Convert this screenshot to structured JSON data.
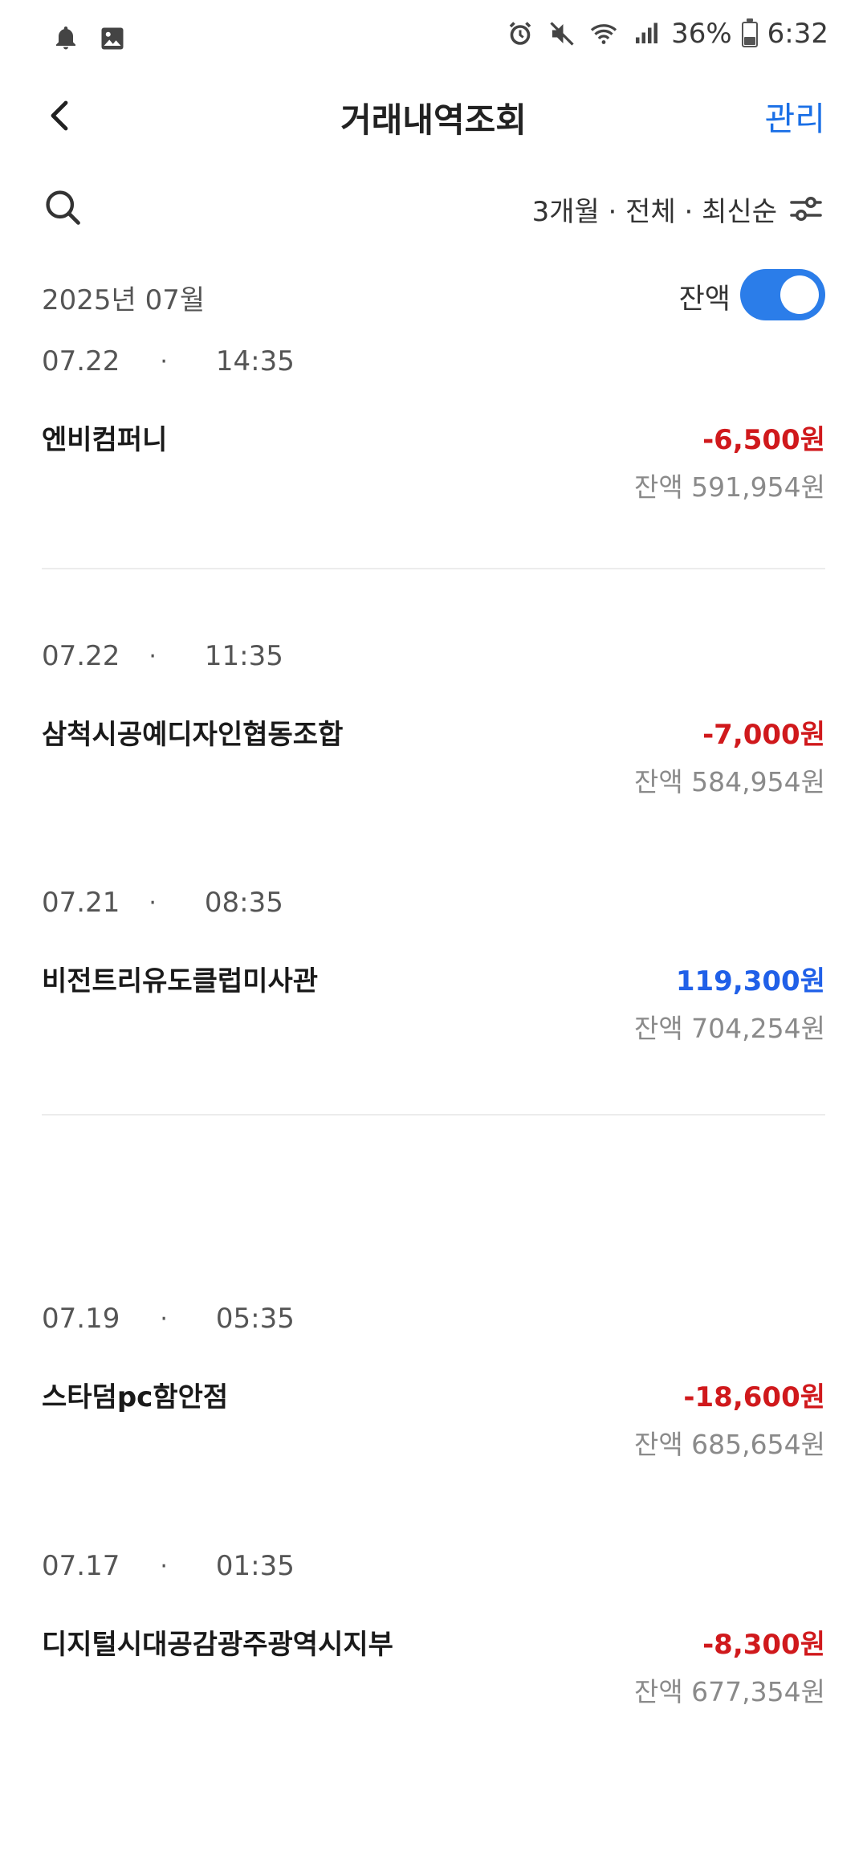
{
  "status_bar": {
    "battery_pct": "36%",
    "battery_level": 0.36,
    "time": "6:32",
    "left_icons": [
      "bell-icon",
      "image-icon"
    ],
    "right_icons": [
      "alarm-icon",
      "mute-icon",
      "wifi-icon",
      "signal-icon",
      "battery-icon"
    ]
  },
  "header": {
    "title": "거래내역조회",
    "manage_label": "관리"
  },
  "filter": {
    "summary": "3개월 · 전체 · 최신순"
  },
  "month": {
    "label": "2025년 07월",
    "balance_toggle_label": "잔액",
    "balance_toggle_on": true
  },
  "colors": {
    "accent": "#1a6fe6",
    "negative": "#d0191c",
    "positive": "#2060e8",
    "toggle": "#2b7de9"
  },
  "transactions": [
    {
      "date": "07.22",
      "dot": "·",
      "time": "14:35",
      "merchant": "엔비컴퍼니",
      "amount": "-6,500원",
      "type": "neg",
      "balance": "잔액 591,954원"
    },
    {
      "date": "07.22",
      "dot": "·",
      "time": "11:35",
      "merchant": "삼척시공예디자인협동조합",
      "amount": "-7,000원",
      "type": "neg",
      "balance": "잔액 584,954원"
    },
    {
      "date": "07.21",
      "dot": "·",
      "time": "08:35",
      "merchant": "비전트리유도클럽미사관",
      "amount": "119,300원",
      "type": "pos",
      "balance": "잔액 704,254원"
    },
    {
      "date": "07.19",
      "dot": "·",
      "time": "05:35",
      "merchant": "스타덤pc함안점",
      "amount": "-18,600원",
      "type": "neg",
      "balance": "잔액 685,654원"
    },
    {
      "date": "07.17",
      "dot": "·",
      "time": "01:35",
      "merchant": "디지털시대공감광주광역시지부",
      "amount": "-8,300원",
      "type": "neg",
      "balance": "잔액 677,354원"
    }
  ]
}
